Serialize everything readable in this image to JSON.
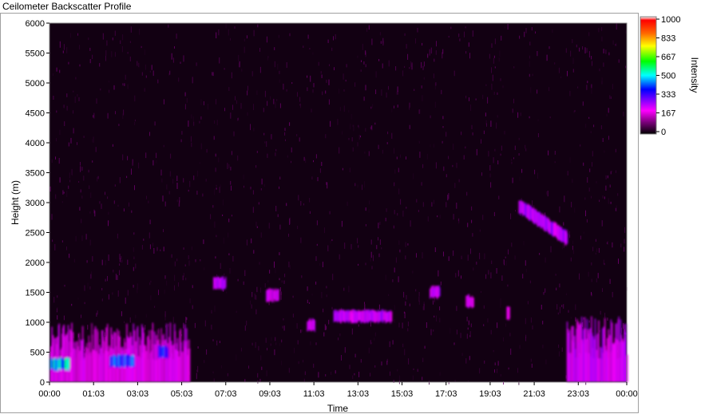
{
  "window": {
    "title": "Ceilometer Backscatter Profile"
  },
  "chart_data": {
    "type": "heatmap",
    "xlabel": "Time",
    "ylabel": "Height (m)",
    "x_ticks": [
      "00:00",
      "01:03",
      "03:03",
      "05:03",
      "07:03",
      "09:03",
      "11:03",
      "13:03",
      "15:03",
      "17:03",
      "19:03",
      "21:03",
      "23:03",
      "00:00"
    ],
    "y_ticks": [
      0,
      500,
      1000,
      1500,
      2000,
      2500,
      3000,
      3500,
      4000,
      4500,
      5000,
      5500,
      6000
    ],
    "ylim": [
      0,
      6000
    ],
    "xlim_hours": [
      0,
      24
    ],
    "colorbar": {
      "label": "Intensity",
      "ticks": [
        "1000",
        "833",
        "667",
        "500",
        "333",
        "167",
        "0"
      ],
      "range": [
        0,
        1000
      ],
      "colors": [
        "#000000",
        "#7a007a",
        "#ff00ff",
        "#0000ff",
        "#00ffff",
        "#00ff00",
        "#ffff00",
        "#ff6600",
        "#ff0000",
        "#ffffff"
      ]
    },
    "background_noise_intensity": 60,
    "features": [
      {
        "name": "boundary layer (night)",
        "x_start_h": 0.0,
        "x_end_h": 5.8,
        "height_m": [
          0,
          1000
        ],
        "intensity": 200
      },
      {
        "name": "low cloud 00:00-01:00",
        "x_start_h": 0.0,
        "x_end_h": 0.8,
        "height_m": 300,
        "intensity": 520
      },
      {
        "name": "low cloud 02:30-03:30",
        "x_start_h": 2.5,
        "x_end_h": 3.5,
        "height_m": 350,
        "intensity": 400
      },
      {
        "name": "cloud 04:40",
        "x_start_h": 4.5,
        "x_end_h": 4.9,
        "height_m": 500,
        "intensity": 380
      },
      {
        "name": "cloud 07:00",
        "x_start_h": 6.8,
        "x_end_h": 7.3,
        "height_m": 1650,
        "intensity": 250
      },
      {
        "name": "cloud 09:30",
        "x_start_h": 9.0,
        "x_end_h": 9.5,
        "height_m": 1450,
        "intensity": 220
      },
      {
        "name": "cloud 10:50",
        "x_start_h": 10.7,
        "x_end_h": 11.0,
        "height_m": 950,
        "intensity": 230
      },
      {
        "name": "cloud 12-14h",
        "x_start_h": 11.8,
        "x_end_h": 14.2,
        "height_m": 1100,
        "intensity": 240
      },
      {
        "name": "cloud 16:00",
        "x_start_h": 15.8,
        "x_end_h": 16.2,
        "height_m": 1500,
        "intensity": 250
      },
      {
        "name": "cloud 17:30",
        "x_start_h": 17.3,
        "x_end_h": 17.6,
        "height_m": 1350,
        "intensity": 220
      },
      {
        "name": "cloud 19:00",
        "x_start_h": 19.0,
        "x_end_h": 19.1,
        "height_m": 1150,
        "intensity": 200
      },
      {
        "name": "cloud 19:30-21:30 (descending)",
        "x_start_h": 19.5,
        "x_end_h": 21.5,
        "height_m": [
          2950,
          2400
        ],
        "intensity": 260
      },
      {
        "name": "boundary layer (evening)",
        "x_start_h": 21.5,
        "x_end_h": 24.0,
        "height_m": [
          0,
          1100
        ],
        "intensity": 230
      }
    ]
  }
}
